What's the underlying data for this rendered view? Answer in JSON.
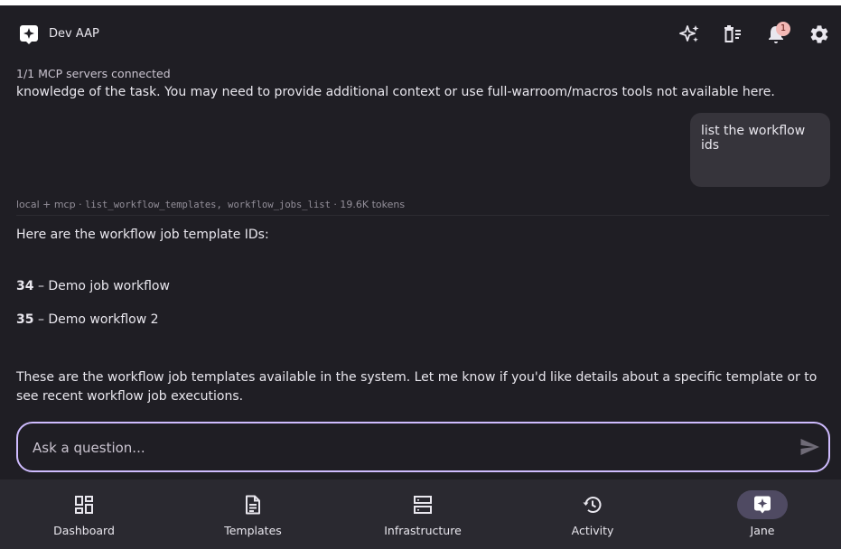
{
  "header": {
    "app_title": "Dev AAP",
    "notification_count": "1",
    "icons": [
      "sparkle-icon",
      "clear-history-icon",
      "bell-icon",
      "gear-icon"
    ]
  },
  "chat": {
    "status": "1/1 MCP servers connected",
    "partial_text": "knowledge of the task. You may need to provide additional context or use full-warroom/macros tools not available here.",
    "user_message": "list the workflow ids",
    "meta": {
      "source": "local + mcp",
      "sep": "·",
      "tools": "list_workflow_templates, workflow_jobs_list",
      "tokens": "19.6K tokens"
    },
    "response": {
      "intro": "Here are the workflow job template IDs:",
      "items": [
        {
          "id": "34",
          "name": "– Demo job workflow"
        },
        {
          "id": "35",
          "name": "– Demo workflow 2"
        }
      ],
      "outro": "These are the workflow job templates available in the system. Let me know if you'd like details about a specific template or to see recent workflow job executions."
    }
  },
  "composer": {
    "placeholder": "Ask a question..."
  },
  "nav": {
    "items": [
      {
        "label": "Dashboard",
        "icon": "dashboard-icon"
      },
      {
        "label": "Templates",
        "icon": "document-icon"
      },
      {
        "label": "Infrastructure",
        "icon": "server-icon"
      },
      {
        "label": "Activity",
        "icon": "history-icon"
      },
      {
        "label": "Jane",
        "icon": "assistant-icon",
        "active": true
      }
    ]
  },
  "colors": {
    "background": "#1f1e24",
    "accent": "#cfbcff",
    "nav_background": "#2a2930",
    "bubble": "#36343b"
  }
}
